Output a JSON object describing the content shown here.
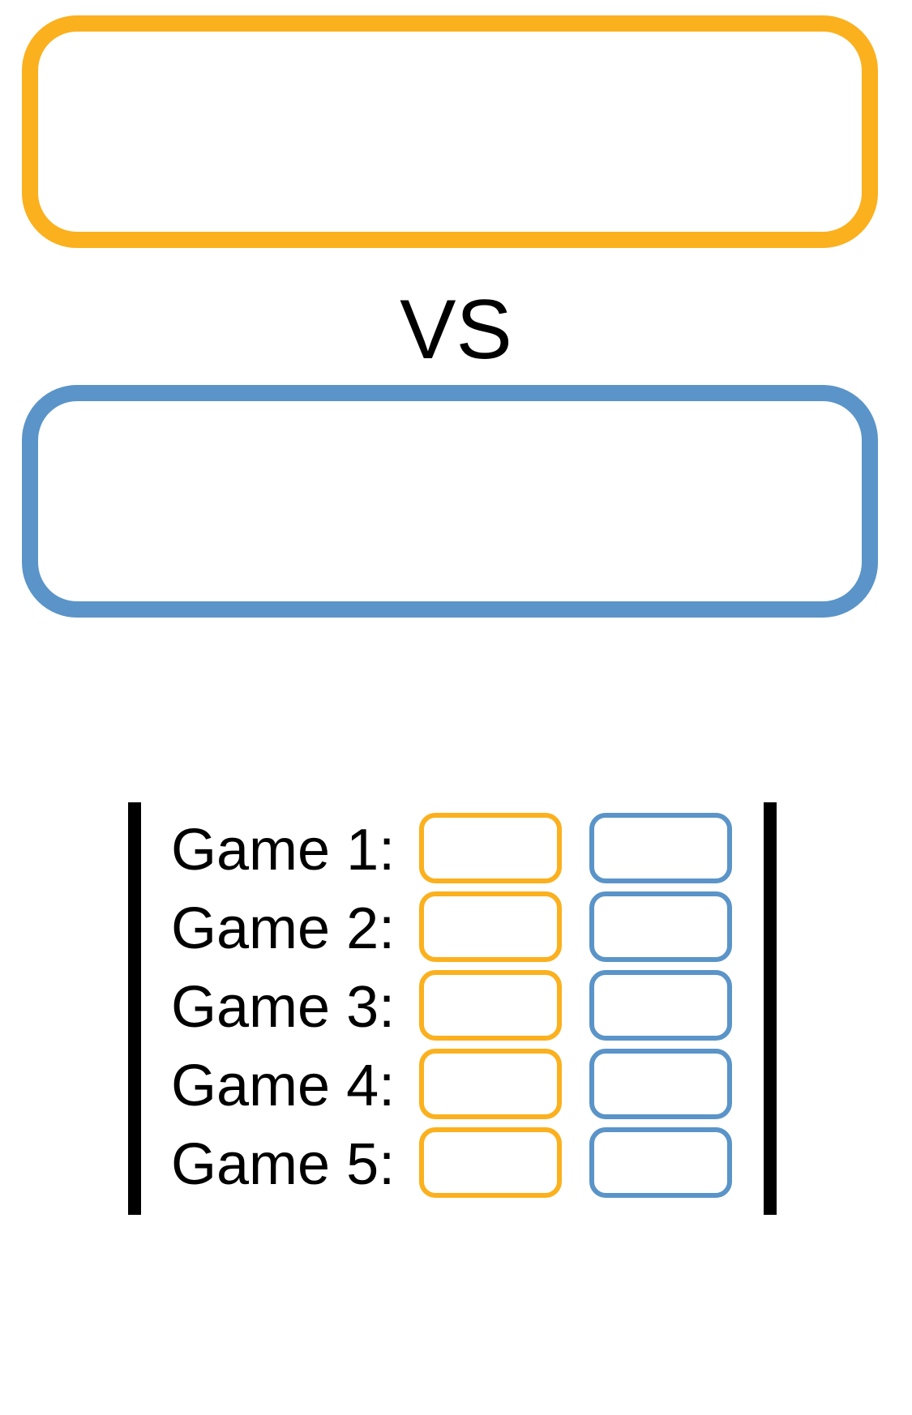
{
  "colors": {
    "team1": "#FBB01E",
    "team2": "#5A94C8"
  },
  "team1": {
    "name": ""
  },
  "team2": {
    "name": ""
  },
  "vs_label": "VS",
  "games": [
    {
      "label": "Game 1:",
      "team1_score": "",
      "team2_score": ""
    },
    {
      "label": "Game 2:",
      "team1_score": "",
      "team2_score": ""
    },
    {
      "label": "Game 3:",
      "team1_score": "",
      "team2_score": ""
    },
    {
      "label": "Game 4:",
      "team1_score": "",
      "team2_score": ""
    },
    {
      "label": "Game 5:",
      "team1_score": "",
      "team2_score": ""
    }
  ]
}
